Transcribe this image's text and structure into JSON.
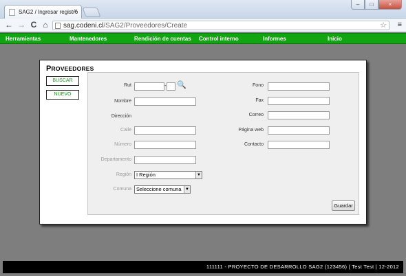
{
  "browser": {
    "tab_title": "SAG2 / Ingresar registro",
    "tab_close": "×",
    "url_host": "sag.codeni.cl",
    "url_path": "/SAG2/Proveedores/Create",
    "back_icon": "←",
    "forward_icon": "→",
    "reload_icon": "C",
    "home_icon": "⌂",
    "star_icon": "☆",
    "menu_icon": "≡",
    "minimize": "–",
    "maximize": "□",
    "close": "×"
  },
  "nav": {
    "items": [
      {
        "label": "Herramientas"
      },
      {
        "label": "Mantenedores"
      },
      {
        "label": "Rendición de cuentas"
      },
      {
        "label": "Control interno"
      },
      {
        "label": "Informes"
      },
      {
        "label": "Inicio"
      }
    ]
  },
  "panel": {
    "title_initial": "P",
    "title_rest": "ROVEEDORES",
    "buscar": "BUSCAR",
    "nuevo": "NUEVO"
  },
  "form": {
    "rut": "Rut",
    "rut_dash": "-",
    "nombre": "Nombre",
    "direccion": "Dirección",
    "calle": "Calle",
    "numero": "Número",
    "departamento": "Departamento",
    "region": "Región",
    "region_value": "I Región",
    "comuna": "Comuna",
    "comuna_value": "Seleccione comuna",
    "fono": "Fono",
    "fax": "Fax",
    "correo": "Correo",
    "pagina_web": "Página web",
    "contacto": "Contacto",
    "guardar": "Guardar",
    "select_arrow": "▼",
    "search_glyph": "🔍"
  },
  "footer": {
    "text": "111111 - PROYECTO DE DESARROLLO SAG2 (123456) | Test Test | 12-2012"
  },
  "colors": {
    "nav_green": "#12a512",
    "button_text_green": "#1a9a1a",
    "background": "#7e7e7e",
    "footer": "#000000"
  }
}
